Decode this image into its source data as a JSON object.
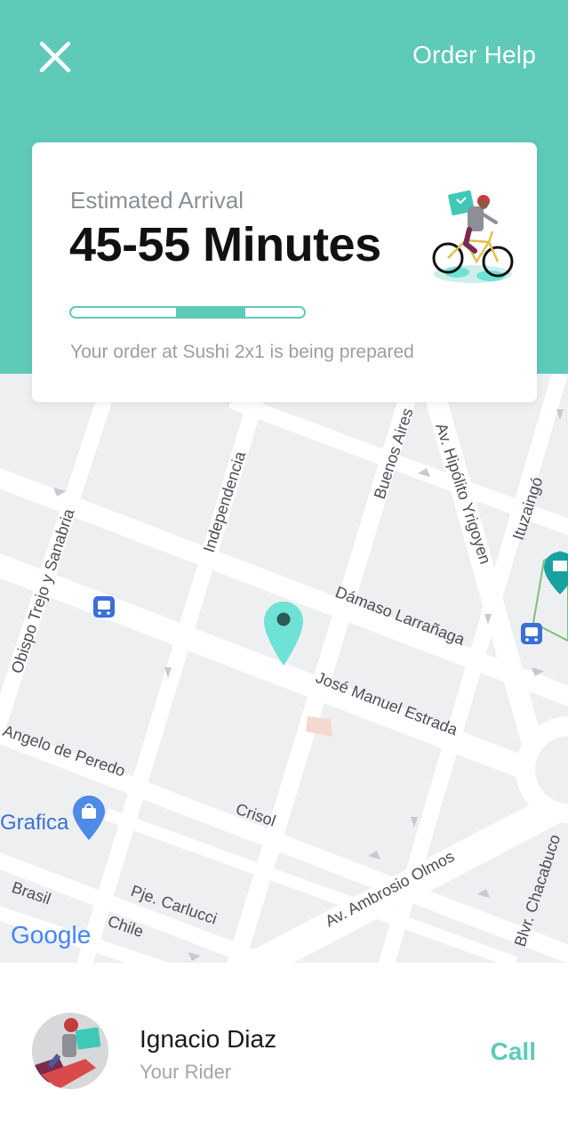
{
  "header": {
    "close_icon": "close-icon",
    "help_label": "Order Help",
    "background_color": "#5ecab8"
  },
  "card": {
    "eta_label": "Estimated Arrival",
    "eta_value": "45-55 Minutes",
    "progress": {
      "segment_start": 0.45,
      "segment_end": 0.75
    },
    "status": "Your order at Sushi 2x1 is being prepared",
    "illustration": "rider-on-bicycle-icon"
  },
  "map": {
    "streets": {
      "buenos_aires": "Buenos Aires",
      "hipolito": "Av. Hipólito Yrigoyen",
      "ituzaingo": "Ituzaingó",
      "independencia": "Independencia",
      "obispo": "Obispo Trejo y Sanabria",
      "damaso": "Dámaso Larrañaga",
      "jose_manuel": "José Manuel Estrada",
      "angelo": "Angelo de Peredo",
      "crisol": "Crisol",
      "ambrosio": "Av. Ambrosio Olmos",
      "brasil": "Brasil",
      "carlucci": "Pje. Carlucci",
      "chile": "Chile",
      "chacabuco": "Blvr. Chacabuco"
    },
    "places": {
      "grafica": "Grafica"
    },
    "logo": "Google",
    "pin_color": "#6ee2d4"
  },
  "rider": {
    "name": "Ignacio Diaz",
    "role": "Your Rider",
    "call_label": "Call",
    "accent_color": "#5ecab8"
  }
}
